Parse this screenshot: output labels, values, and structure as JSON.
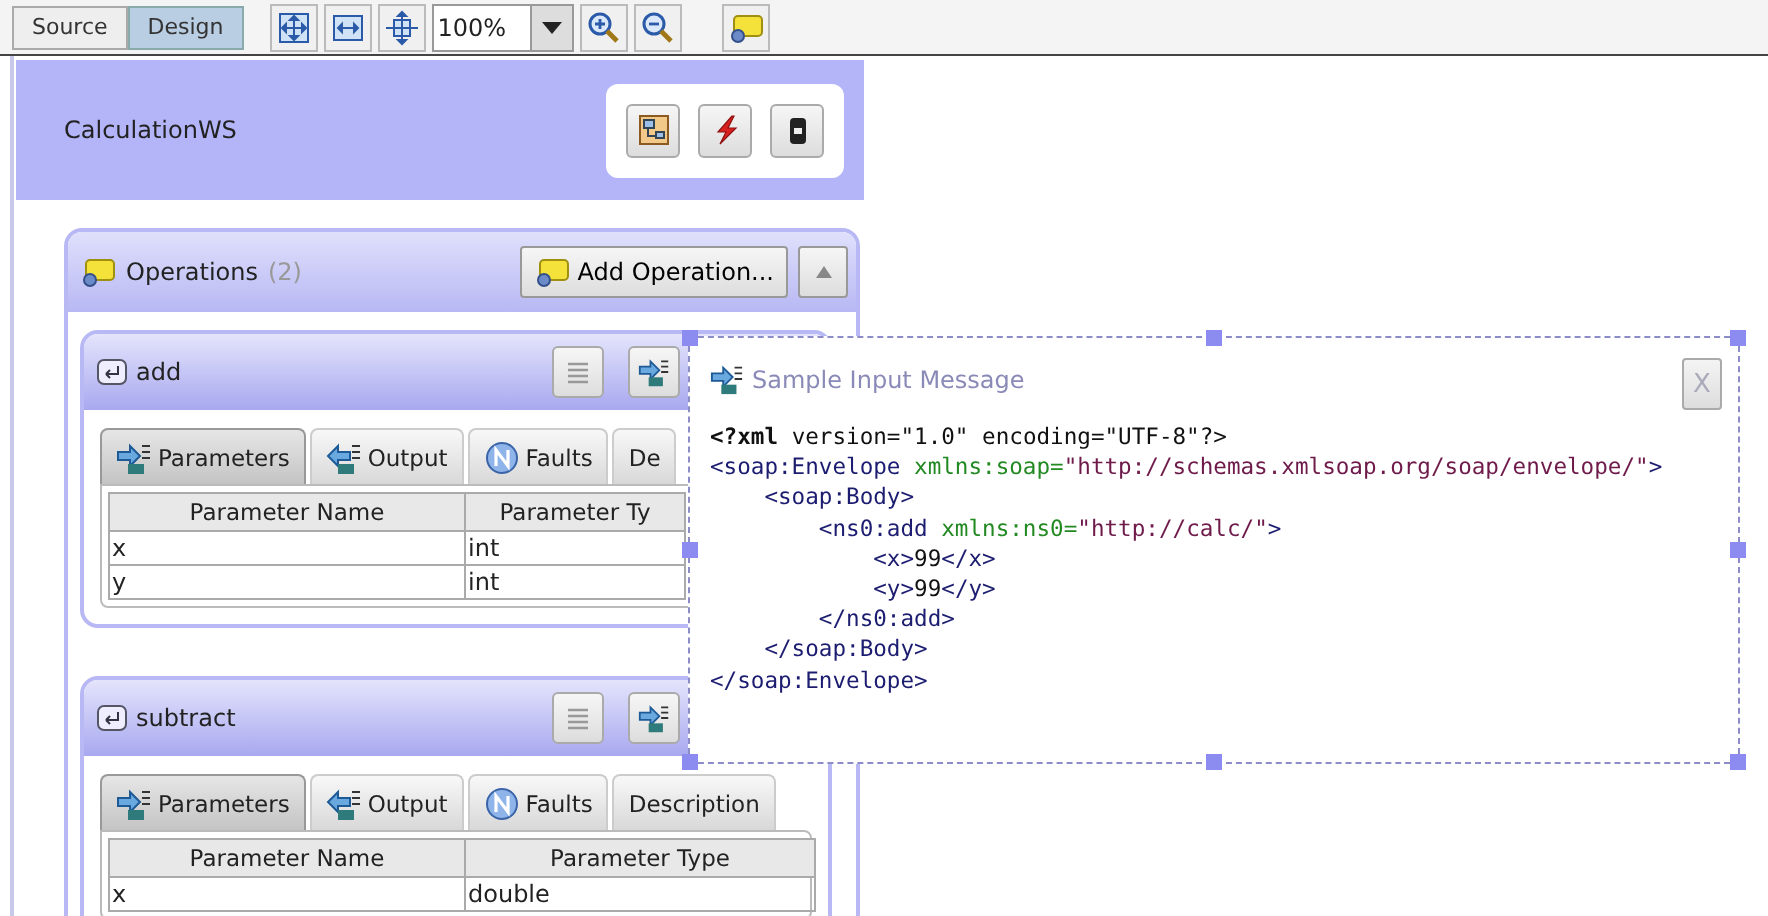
{
  "toolbar": {
    "view_tabs": [
      {
        "label": "Source",
        "selected": false
      },
      {
        "label": "Design",
        "selected": true
      }
    ],
    "zoom": "100%"
  },
  "service": {
    "name": "CalculationWS"
  },
  "operations_panel": {
    "title": "Operations",
    "count": "(2)",
    "add_button": "Add Operation...",
    "expanded": true
  },
  "operations": [
    {
      "name": "add",
      "tabs": [
        {
          "label": "Parameters",
          "kind": "in",
          "selected": true
        },
        {
          "label": "Output",
          "kind": "out",
          "selected": false
        },
        {
          "label": "Faults",
          "kind": "faults",
          "selected": false
        },
        {
          "label": "De",
          "kind": "plain",
          "selected": false
        }
      ],
      "table": {
        "columns": [
          "Parameter Name",
          "Parameter Ty"
        ],
        "rows": [
          [
            "x",
            "int"
          ],
          [
            "y",
            "int"
          ]
        ]
      }
    },
    {
      "name": "subtract",
      "tabs": [
        {
          "label": "Parameters",
          "kind": "in",
          "selected": true
        },
        {
          "label": "Output",
          "kind": "out",
          "selected": false
        },
        {
          "label": "Faults",
          "kind": "faults",
          "selected": false
        },
        {
          "label": "Description",
          "kind": "plain",
          "selected": false
        }
      ],
      "table": {
        "columns": [
          "Parameter Name",
          "Parameter Type"
        ],
        "rows": [
          [
            "x",
            "double"
          ]
        ]
      }
    }
  ],
  "sample_popup": {
    "title": "Sample Input Message",
    "close": "X",
    "lines": [
      [
        {
          "kind": "decl",
          "text": "<?xml"
        },
        {
          "kind": "text",
          "text": " version=\"1.0\" encoding=\"UTF-8\"?>"
        }
      ],
      [
        {
          "kind": "tag",
          "text": "<soap:Envelope"
        },
        {
          "kind": "attr",
          "text": " xmlns:soap="
        },
        {
          "kind": "value",
          "text": "\"http://schemas.xmlsoap.org/soap/envelope/\""
        },
        {
          "kind": "tag",
          "text": ">"
        }
      ],
      [
        {
          "kind": "tag",
          "text": "    <soap:Body>"
        }
      ],
      [
        {
          "kind": "tag",
          "text": "        <ns0:add"
        },
        {
          "kind": "attr",
          "text": " xmlns:ns0="
        },
        {
          "kind": "value",
          "text": "\"http://calc/\""
        },
        {
          "kind": "tag",
          "text": ">"
        }
      ],
      [
        {
          "kind": "tag",
          "text": "            <x>"
        },
        {
          "kind": "text",
          "text": "99"
        },
        {
          "kind": "tag",
          "text": "</x>"
        }
      ],
      [
        {
          "kind": "tag",
          "text": "            <y>"
        },
        {
          "kind": "text",
          "text": "99"
        },
        {
          "kind": "tag",
          "text": "</y>"
        }
      ],
      [
        {
          "kind": "tag",
          "text": "        </ns0:add>"
        }
      ],
      [
        {
          "kind": "tag",
          "text": "    </soap:Body>"
        }
      ],
      [
        {
          "kind": "tag",
          "text": "</soap:Envelope>"
        }
      ]
    ]
  }
}
